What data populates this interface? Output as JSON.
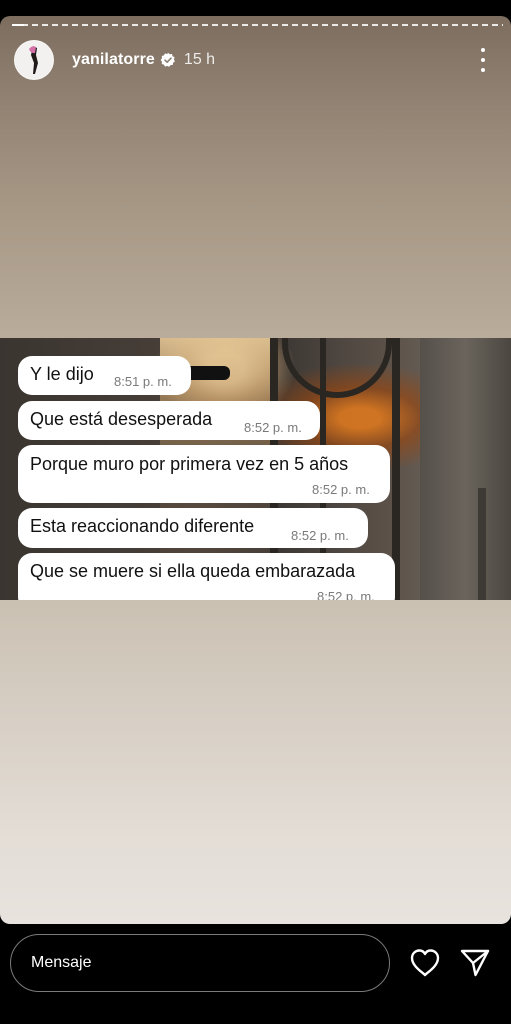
{
  "story": {
    "username": "yanilatorre",
    "verified": true,
    "time_ago": "15 h",
    "more_icon": "more-vertical-icon"
  },
  "messages": [
    {
      "text": "Y le dijo",
      "time": "8:51 p. m."
    },
    {
      "text": "Que está desesperada",
      "time": "8:52 p. m."
    },
    {
      "text": "Porque muro por primera vez en 5 años",
      "time": "8:52 p. m."
    },
    {
      "text": "Esta reaccionando diferente",
      "time": "8:52 p. m."
    },
    {
      "text": "Que se muere si ella queda embarazada",
      "time": "8:52 p. m."
    }
  ],
  "reply_bar": {
    "placeholder": "Mensaje",
    "like_icon": "heart-icon",
    "send_icon": "send-icon"
  },
  "colors": {
    "background": "#000000",
    "bubble": "#ffffff",
    "timestamp": "#7a7a7a"
  }
}
